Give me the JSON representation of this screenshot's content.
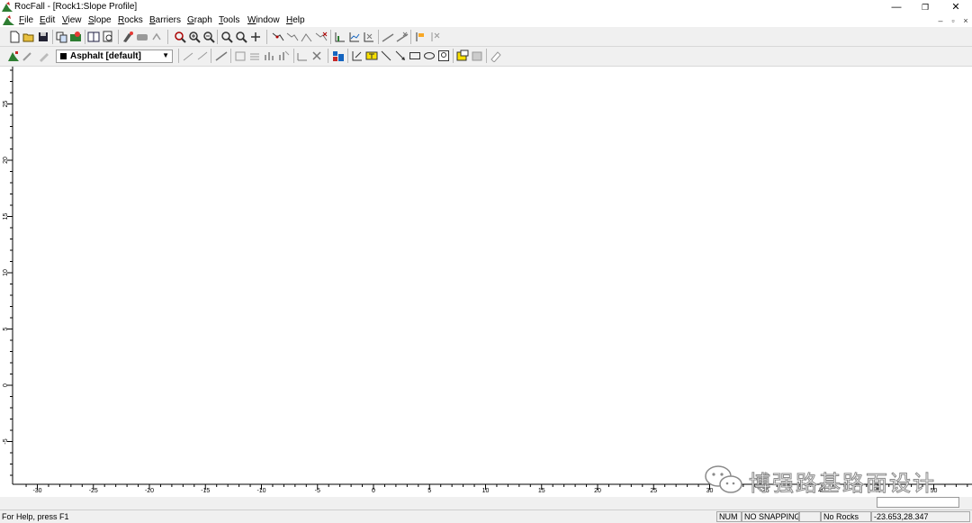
{
  "app": {
    "title": "RocFall - [Rock1:Slope Profile]",
    "window_controls": [
      "—",
      "❐",
      "✕"
    ],
    "mdi_controls": [
      "–",
      "▫",
      "×"
    ]
  },
  "menu": [
    {
      "label": "File",
      "key": "F",
      "rest": "ile"
    },
    {
      "label": "Edit",
      "key": "E",
      "rest": "dit"
    },
    {
      "label": "View",
      "key": "V",
      "rest": "iew"
    },
    {
      "label": "Slope",
      "key": "S",
      "rest": "lope"
    },
    {
      "label": "Rocks",
      "key": "R",
      "rest": "ocks"
    },
    {
      "label": "Barriers",
      "key": "B",
      "rest": "arriers"
    },
    {
      "label": "Graph",
      "key": "G",
      "rest": "raph"
    },
    {
      "label": "Tools",
      "key": "T",
      "rest": "ools"
    },
    {
      "label": "Window",
      "key": "W",
      "rest": "indow"
    },
    {
      "label": "Help",
      "key": "H",
      "rest": "elp"
    }
  ],
  "toolbar": {
    "material_select": {
      "value": "Asphalt [default]",
      "swatch_color": "#000000"
    }
  },
  "axes": {
    "x_ticks": [
      "-30",
      "-25",
      "-20",
      "-15",
      "-10",
      "-5",
      "0",
      "5",
      "10",
      "15",
      "20",
      "25",
      "30",
      "35",
      "40",
      "45",
      "50"
    ],
    "y_ticks": [
      "25",
      "20",
      "15",
      "10",
      "5",
      "0",
      "-5"
    ]
  },
  "status": {
    "help": "For Help, press F1",
    "num": "NUM",
    "snapping": "NO SNAPPING",
    "rocks": "No Rocks",
    "coords": "-23.653,28.347"
  },
  "watermark": {
    "text": "博强路基路面设计"
  }
}
